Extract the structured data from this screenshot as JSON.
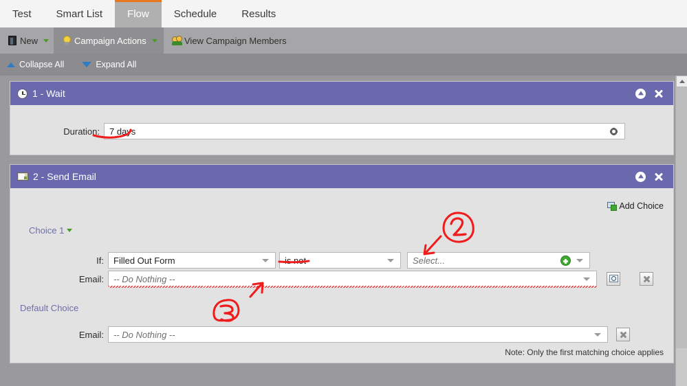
{
  "tabs": [
    {
      "label": "Test",
      "active": false
    },
    {
      "label": "Smart List",
      "active": false
    },
    {
      "label": "Flow",
      "active": true
    },
    {
      "label": "Schedule",
      "active": false
    },
    {
      "label": "Results",
      "active": false
    }
  ],
  "actionbar": {
    "new": {
      "label": "New",
      "icon": "page-icon",
      "caret": true
    },
    "campaign_actions": {
      "label": "Campaign Actions",
      "icon": "lightbulb-icon",
      "caret": true
    },
    "view_members": {
      "label": "View Campaign Members",
      "icon": "people-icon"
    }
  },
  "treecontrols": {
    "collapse": "Collapse All",
    "expand": "Expand All"
  },
  "steps": [
    {
      "number": "1",
      "title": "1 - Wait",
      "icon": "clock-icon",
      "duration_label": "Duration:",
      "duration_value": "7 days"
    },
    {
      "number": "2",
      "title": "2 - Send Email",
      "icon": "email-icon",
      "add_choice_label": "Add Choice",
      "choice_label": "Choice 1",
      "if_label": "If:",
      "if_value": "Filled Out Form",
      "operator_value": "is not",
      "select_placeholder": "Select...",
      "email_label": "Email:",
      "email_value": "-- Do Nothing --",
      "default_choice_label": "Default Choice",
      "default_email_label": "Email:",
      "default_email_value": "-- Do Nothing --",
      "note": "Note: Only the first matching choice applies"
    }
  ],
  "annotations": [
    {
      "id": "1",
      "kind": "underline",
      "target": "duration-value"
    },
    {
      "id": "2",
      "kind": "circled-number",
      "text": "2",
      "target": "select-field"
    },
    {
      "id": "3",
      "kind": "circled-number",
      "text": "3",
      "target": "email-field"
    },
    {
      "id": "4",
      "kind": "underline",
      "target": "operator-value"
    }
  ],
  "colors": {
    "panel_header": "#6a69ad",
    "active_tab_accent": "#e8761c",
    "annotation_red": "#f01b1b",
    "link_purple": "#6f6fa8",
    "canvas": "#9a9a9e"
  }
}
